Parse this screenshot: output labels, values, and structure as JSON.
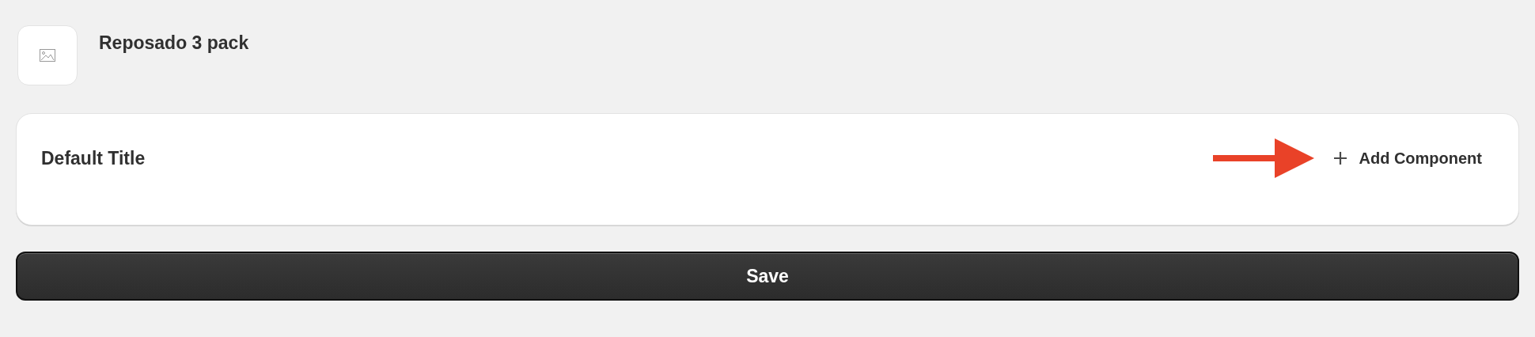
{
  "product": {
    "title": "Reposado 3 pack",
    "thumbnail": {
      "kind": "placeholder"
    }
  },
  "variant_card": {
    "title": "Default Title",
    "add_button": {
      "label": "Add Component"
    },
    "annotation_arrow": {
      "color": "#e94228"
    }
  },
  "save_button": {
    "label": "Save"
  }
}
